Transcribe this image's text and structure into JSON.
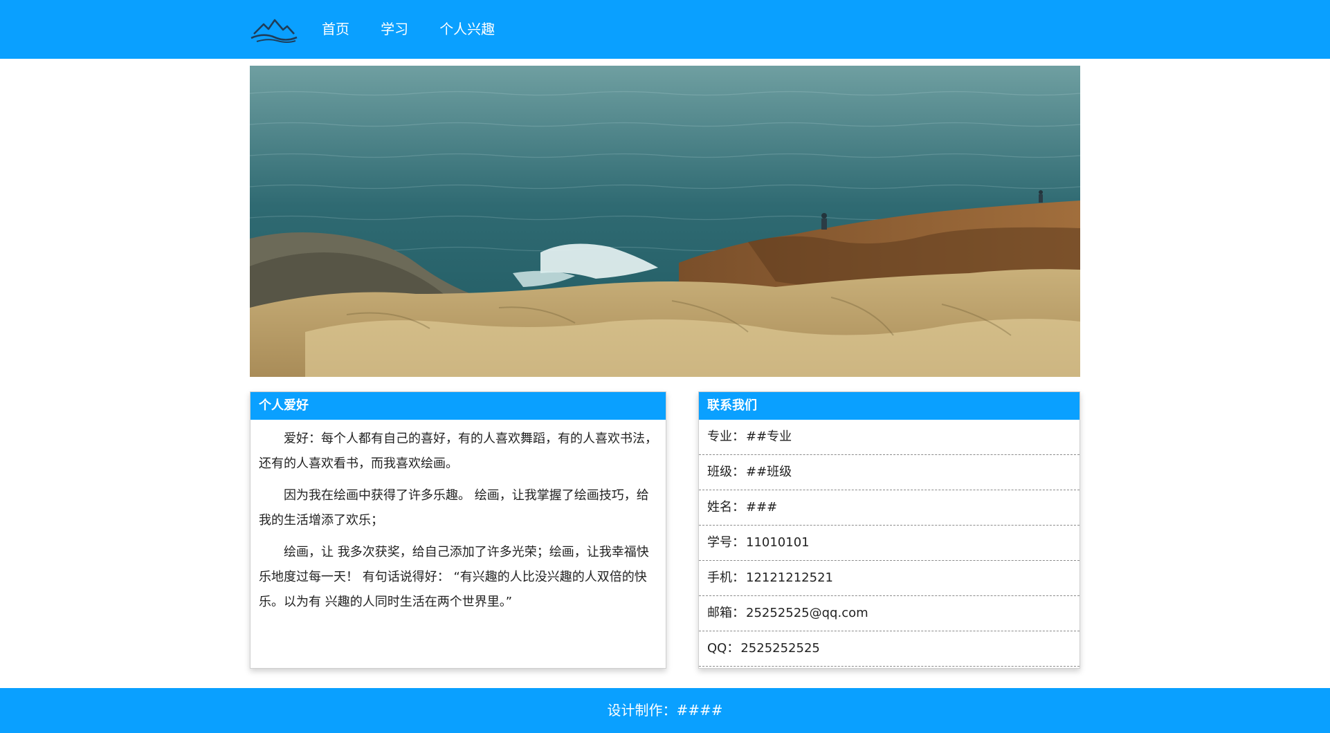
{
  "header": {
    "logo_icon": "mountain-logo-icon",
    "nav": [
      "首页",
      "学习",
      "个人兴趣"
    ]
  },
  "banner": {
    "image_icon": "sea-rocks-photo"
  },
  "hobby": {
    "title": "个人爱好",
    "paragraphs": [
      "爱好：每个人都有自己的喜好，有的人喜欢舞蹈，有的人喜欢书法， 还有的人喜欢看书，而我喜欢绘画。",
      "因为我在绘画中获得了许多乐趣。 绘画，让我掌握了绘画技巧，给我的生活增添了欢乐；",
      "绘画，让 我多次获奖，给自己添加了许多光荣；绘画，让我幸福快乐地度过每一天！ 有句话说得好： “有兴趣的人比没兴趣的人双倍的快乐。以为有 兴趣的人同时生活在两个世界里。”"
    ]
  },
  "contact": {
    "title": "联系我们",
    "items": [
      {
        "label": "专业：",
        "value": "##专业"
      },
      {
        "label": "班级：",
        "value": "##班级"
      },
      {
        "label": "姓名：",
        "value": "###"
      },
      {
        "label": "学号：",
        "value": "11010101"
      },
      {
        "label": "手机：",
        "value": "12121212521"
      },
      {
        "label": "邮箱：",
        "value": "25252525@qq.com"
      },
      {
        "label": "QQ：",
        "value": "2525252525"
      }
    ]
  },
  "footer": {
    "text": "设计制作：####"
  },
  "colors": {
    "primary": "#0aa0ff"
  }
}
